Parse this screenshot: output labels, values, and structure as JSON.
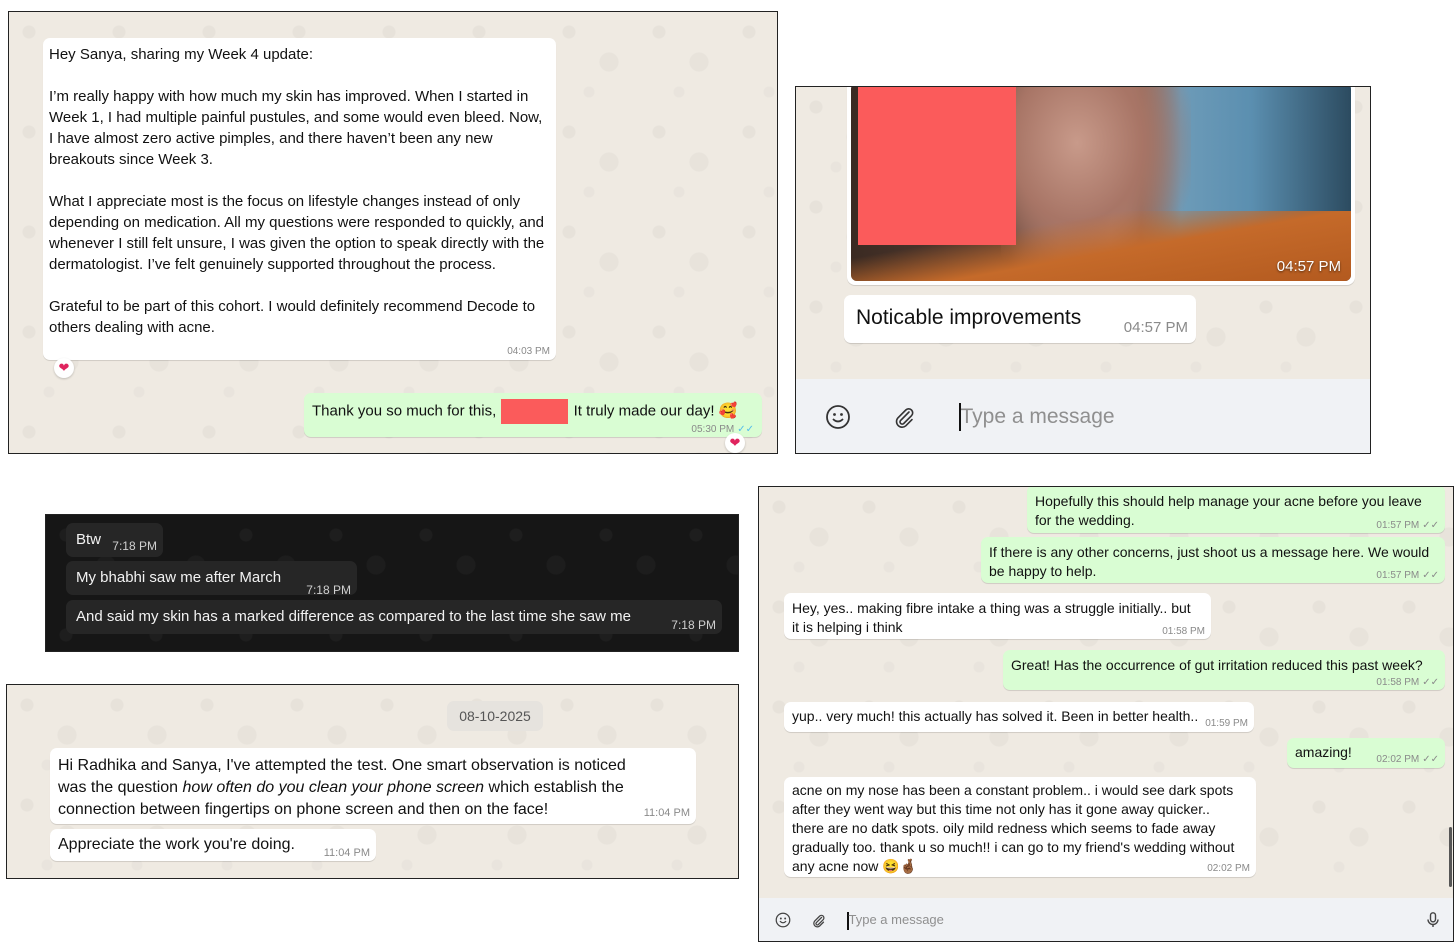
{
  "panel1": {
    "message_greeting": "Hey Sanya, sharing my Week 4 update:",
    "message_p1": "I’m really happy with how much my skin has improved. When I started in Week 1, I had multiple painful pustules, and some would even bleed. Now, I have almost zero active pimples, and there haven’t been any new breakouts since Week 3.",
    "message_p2": "What I appreciate most is the focus on lifestyle changes instead of only depending on medication. All my questions were responded to quickly, and whenever I still felt unsure, I was given the option to speak directly with the dermatologist. I’ve felt genuinely supported throughout the process.",
    "message_p3": "Grateful to be part of this cohort. I would definitely recommend Decode to others dealing with acne.",
    "message_time": "04:03 PM",
    "reply_before": "Thank you so much for this,",
    "reply_after": "It truly made our day! 🥰",
    "reply_time": "05:30 PM",
    "reaction": "❤"
  },
  "panel2": {
    "photo_time": "04:57 PM",
    "caption": "Noticable improvements",
    "caption_time": "04:57 PM",
    "input_placeholder": "Type a message"
  },
  "panel3": {
    "messages": [
      {
        "text": "Btw",
        "time": "7:18 PM"
      },
      {
        "text": "My bhabhi saw me after March",
        "time": "7:18 PM"
      },
      {
        "text": "And said my skin has a marked difference as compared to the last time she saw me",
        "time": "7:18 PM"
      }
    ]
  },
  "panel4": {
    "date_chip": "08-10-2025",
    "msg1_a": "Hi Radhika and Sanya, I've attempted the test. One smart observation is noticed was the question",
    "msg1_italic": "how often do you clean your phone screen",
    "msg1_b": "which establish the connection between fingertips on phone screen and then on the face!",
    "msg1_time": "11:04 PM",
    "msg2": "Appreciate the work you're doing.",
    "msg2_time": "11:04 PM"
  },
  "panel5": {
    "messages": [
      {
        "text": "Hopefully this should help manage your acne before you leave for the wedding.",
        "time": "01:57 PM"
      },
      {
        "text": "If there is any other concerns, just shoot us a message here. We would be happy to help.",
        "time": "01:57 PM"
      },
      {
        "text": "Hey, yes.. making fibre intake a thing was a struggle initially.. but it is helping i think",
        "time": "01:58 PM"
      },
      {
        "text": "Great! Has the occurrence of gut irritation reduced this past week?",
        "time": "01:58 PM"
      },
      {
        "text": "yup.. very much! this actually has solved it. Been in better health..",
        "time": "01:59 PM"
      },
      {
        "text": "amazing!",
        "time": "02:02 PM"
      },
      {
        "text": "acne on my nose has been a constant problem.. i would see dark spots after they went way but this time not only has it gone away quicker.. there are no datk spots. oily mild redness which seems to fade away gradually too. thank u so much!! i can go to my friend's wedding without any acne now 😆🤞🏾",
        "time": "02:02 PM"
      }
    ],
    "input_placeholder": "Type a message"
  },
  "icons": [
    "emoji-icon",
    "attach-icon",
    "mic-icon",
    "heart-icon",
    "read-ticks-icon"
  ],
  "colors": {
    "outgoing": "#d9fdd3",
    "incoming": "#ffffff",
    "wallpaper": "#efeae2",
    "redaction": "#fb5b5b",
    "read_ticks": "#53bdeb"
  }
}
